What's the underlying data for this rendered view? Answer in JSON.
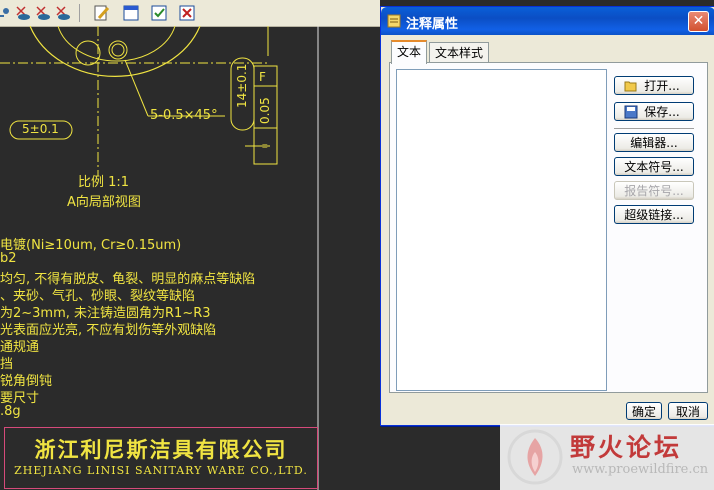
{
  "toolbar": {
    "icons": [
      "show-hide-icon",
      "annotation-show-icon",
      "annotation-hide-icon",
      "edit-note-icon",
      "window-icon",
      "checkbox-icon",
      "close-icon"
    ]
  },
  "drawing": {
    "dim_chamfer": "5-0.5×45°",
    "dim_5": "5±0.1",
    "dim_14": "14±0.1",
    "dim_005": "0.05",
    "datum_f": "F",
    "scale_label": "比例 1:1",
    "view_label": "A向局部视图",
    "notes": [
      "电镀(Ni≥10um, Cr≥0.15um)",
      "b2",
      "均匀, 不得有脱皮、龟裂、明显的麻点等缺陷",
      "、夹砂、气孔、砂眼、裂纹等缺陷",
      "为2~3mm, 未注铸造圆角为R1~R3",
      "光表面应光亮, 不应有划伤等外观缺陷",
      "通规通",
      "挡",
      "锐角倒钝",
      "要尺寸",
      ".8g"
    ],
    "company_cn": "浙江利尼斯洁具有限公司",
    "company_en": "ZHEJIANG LINISI SANITARY WARE CO.,LTD."
  },
  "dialog": {
    "title": "注释属性",
    "close": "✕",
    "tabs": [
      "文本",
      "文本样式"
    ],
    "buttons": {
      "open": "打开...",
      "save": "保存...",
      "editor": "编辑器...",
      "text_symbol": "文本符号...",
      "report_symbol": "报告符号...",
      "hyperlink": "超级链接..."
    },
    "ok": "确定",
    "cancel": "取消"
  },
  "watermark": {
    "cn": "野火论坛",
    "url": "www.proewildfire.cn"
  }
}
